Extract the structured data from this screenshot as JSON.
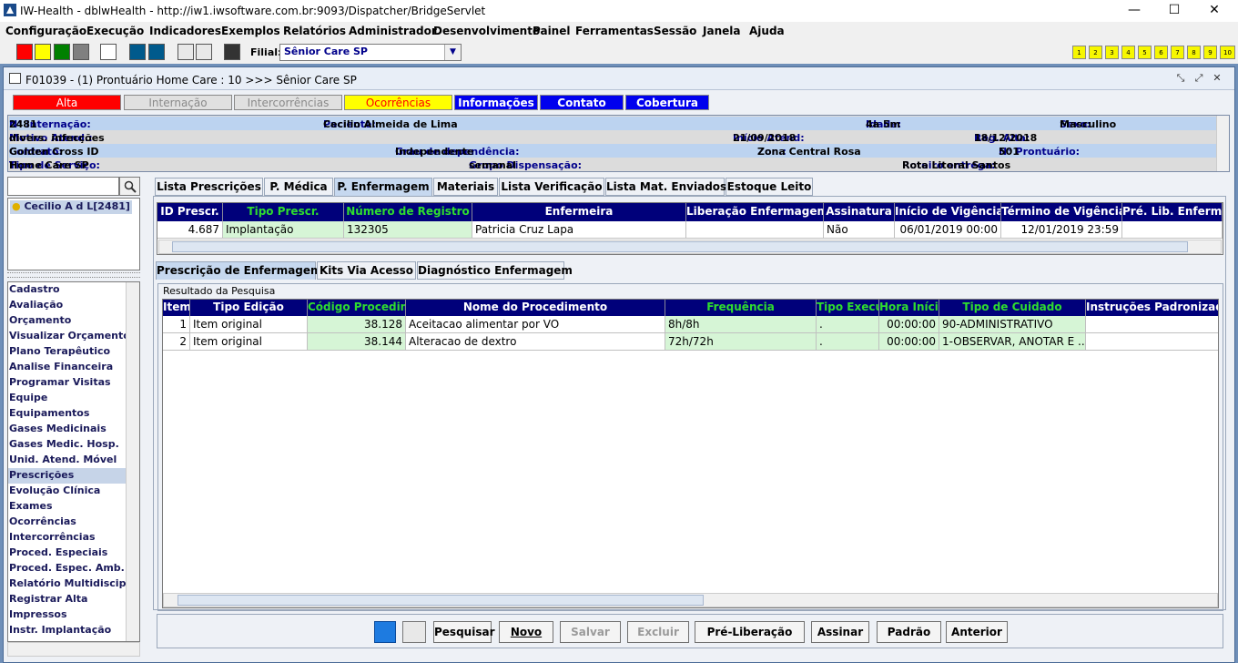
{
  "app": {
    "title": "IW-Health - dblwHealth - http://iw1.iwsoftware.com.br:9093/Dispatcher/BridgeServlet"
  },
  "window_controls": {
    "minimize": "—",
    "maximize": "☐",
    "close": "✕"
  },
  "menu": [
    "Configuração",
    "Execução",
    "Indicadores",
    "Exemplos",
    "Relatórios",
    "Administrador",
    "Desenvolvimento",
    "Painel",
    "Ferramentas",
    "Sessão",
    "Janela",
    "Ajuda"
  ],
  "toolbar": {
    "filial_label": "Filial:",
    "filial_value": "Sênior Care SP",
    "numbers": [
      "1",
      "2",
      "3",
      "4",
      "5",
      "6",
      "7",
      "8",
      "9",
      "10"
    ],
    "colors": [
      "#ff0000",
      "#ffff00",
      "#008000",
      "#808080",
      "#ffffff",
      "#005a8c",
      "#005a8c"
    ]
  },
  "inner_window": {
    "title": "F01039 - (1) Prontuário Home Care : 10 >>> Sênior Care SP"
  },
  "status_tabs": [
    {
      "label": "Alta",
      "bg": "#ff0000",
      "fg": "#ffffff"
    },
    {
      "label": "Internação",
      "bg": "#e0e0e0",
      "fg": "#8a8a8a"
    },
    {
      "label": "Intercorrências",
      "bg": "#e0e0e0",
      "fg": "#8a8a8a"
    },
    {
      "label": "Ocorrências",
      "bg": "#ffff00",
      "fg": "#ff0000"
    },
    {
      "label": "Informações",
      "bg": "#0000ee",
      "fg": "#ffffff"
    },
    {
      "label": "Contato",
      "bg": "#0000ee",
      "fg": "#ffffff"
    },
    {
      "label": "Cobertura",
      "bg": "#0000ee",
      "fg": "#ffffff"
    }
  ],
  "patient_info": {
    "internacao_label": "N° Internação:",
    "internacao": "2481",
    "paciente_label": "Paciente:",
    "paciente": "Cecilio Almeida de Lima",
    "idade_label": "Idade:",
    "idade": "4a 5m",
    "sexo_label": "Sexo:",
    "sexo": "Masculino",
    "motivo_label": "Motivo Atend.:",
    "motivo": "divers. infecções",
    "inicio_label": "Início Atend:",
    "inicio": "21/09/2018",
    "alta_label": "Reg. Alta:",
    "alta": "18/12/2018",
    "contrato_label": "Contrato:",
    "contrato": "Golden Cross ID",
    "grau_label": "Grau de dependência:",
    "grau": "Independente",
    "zona_label": "Zon.:",
    "zona": "Zona Central Rosa",
    "prontuario_label": "N° Prontuário:",
    "prontuario": "501",
    "servico_label": "Tipo de Serviço:",
    "servico": "Home Care SP",
    "grupo_label": "Grupo Dispensação:",
    "grupo": "semanal",
    "roteiro_label": "Roteiro entrega:",
    "roteiro": "Rota Litoral Santos"
  },
  "patient_list": [
    "Cecilio A d L[2481]"
  ],
  "nav_items": [
    "Cadastro",
    "Avaliação",
    "Orçamento",
    "Visualizar Orçamento",
    "Plano Terapêutico",
    "Analise Financeira",
    "Programar Visitas",
    "Equipe",
    "Equipamentos",
    "Gases Medicinais",
    "Gases Medic. Hosp.",
    "Unid. Atend. Móvel",
    "Prescrições",
    "Evolução Clínica",
    "Exames",
    "Ocorrências",
    "Intercorrências",
    "Proced. Especiais",
    "Proced. Espec. Amb.",
    "Relatório Multidisciplina",
    "Registrar Alta",
    "Impressos",
    "Instr. Implantação"
  ],
  "nav_selected": "Prescrições",
  "main_tabs": [
    "Lista Prescrições",
    "P. Médica",
    "P. Enfermagem",
    "Materiais",
    "Lista Verificação",
    "Lista Mat. Enviados",
    "Estoque Leito"
  ],
  "top_grid": {
    "headers": [
      "ID Prescr.",
      "Tipo Prescr.",
      "Número de Registro",
      "Enfermeira",
      "Liberação Enfermagem",
      "Assinatura",
      "Início de Vigência",
      "Término de Vigência",
      "Pré. Lib. Enfermag"
    ],
    "rows": [
      [
        "4.687",
        "Implantação",
        "132305",
        "Patricia Cruz Lapa",
        "",
        "Não",
        "06/01/2019 00:00",
        "12/01/2019 23:59",
        ""
      ]
    ]
  },
  "sub_tabs": [
    "Prescrição de Enfermagem",
    "Kits Via Acesso",
    "Diagnóstico Enfermagem"
  ],
  "group_title": "Resultado da Pesquisa",
  "proc_grid": {
    "headers": [
      "Item",
      "Tipo Edição",
      "Código Procedime",
      "Nome do Procedimento",
      "Frequência",
      "Tipo Execu",
      "Hora Início",
      "Tipo de Cuidado",
      "Instruções Padronizadas"
    ],
    "rows": [
      [
        "1",
        "Item original",
        "38.128",
        "Aceitacao alimentar por VO",
        "8h/8h",
        ".",
        "00:00:00",
        "90-ADMINISTRATIVO",
        ""
      ],
      [
        "2",
        "Item original",
        "38.144",
        "Alteracao de dextro",
        "72h/72h",
        ".",
        "00:00:00",
        "1-OBSERVAR, ANOTAR E ...",
        ""
      ]
    ]
  },
  "buttons": [
    "Pesquisar",
    "Novo",
    "Salvar",
    "Excluir",
    "Pré-Liberação",
    "Assinar",
    "Padrão",
    "Anterior"
  ],
  "disabled_buttons": [
    "Salvar",
    "Excluir"
  ]
}
